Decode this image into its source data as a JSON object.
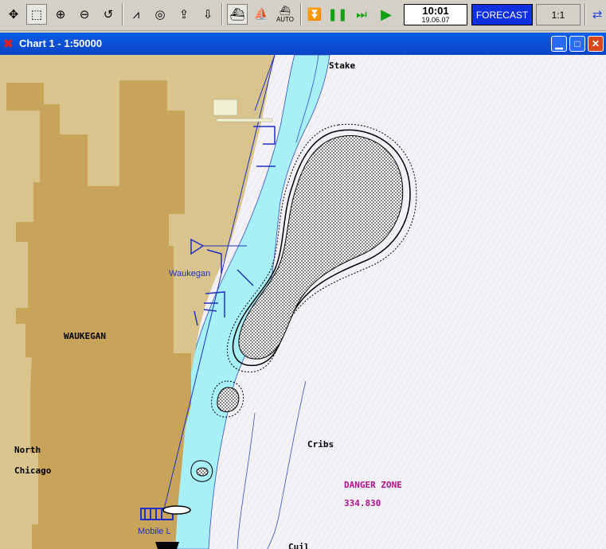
{
  "toolbar": {
    "tools": [
      "pan-icon",
      "select-icon",
      "zoom-in-icon",
      "zoom-out-icon",
      "undo-icon",
      "compass-icon",
      "target-icon",
      "upload-icon",
      "load-icon",
      "ship-icon",
      "route-icon",
      "auto-icon",
      "step-down-icon",
      "pause-icon",
      "fast-forward-icon",
      "play-icon"
    ],
    "auto_label": "AUTO",
    "time": "10:01",
    "date": "19.06.07",
    "forecast_label": "FORECAST",
    "scale_label": "1:1"
  },
  "window": {
    "title": "Chart 1 - 1:50000",
    "minimize_icon": "minimize-icon",
    "maximize_icon": "maximize-icon",
    "close_icon": "close-icon"
  },
  "chart": {
    "labels": {
      "stake": "Stake",
      "waukegan_port": "Waukegan",
      "waukegan": "WAUKEGAN",
      "north": "North",
      "chicago": "Chicago",
      "cribs": "Cribs",
      "danger_zone": "DANGER ZONE",
      "danger_value": "334.830",
      "mobile": "Mobile L",
      "bottom_partial": "Cuil"
    },
    "colors": {
      "land_dark": "#c8a45a",
      "land_light": "#d8c48c",
      "shallow_water": "#a8f0f8",
      "deep_water": "#f4f2f6",
      "forecast_bg": "#1030e0",
      "danger_text": "#b01090"
    }
  }
}
